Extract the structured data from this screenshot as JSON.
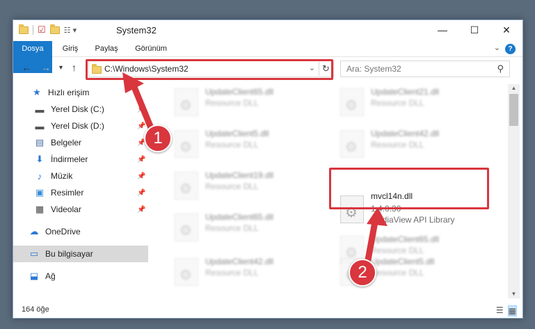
{
  "window": {
    "title": "System32",
    "controls": {
      "minimize": "—",
      "maximize": "☐",
      "close": "✕"
    }
  },
  "ribbon": {
    "tabs": [
      "Dosya",
      "Giriş",
      "Paylaş",
      "Görünüm"
    ],
    "help": "?"
  },
  "address": {
    "path": "C:\\Windows\\System32",
    "refresh_icon": "↻"
  },
  "search": {
    "placeholder": "Ara: System32"
  },
  "sidebar": {
    "items": [
      {
        "label": "Hızlı erişim",
        "icon": "star-icon",
        "glyph": "★",
        "color": "#2b78d4",
        "pinned": false
      },
      {
        "label": "Yerel Disk (C:)",
        "icon": "drive-icon",
        "glyph": "▬",
        "color": "#555555",
        "pinned": true
      },
      {
        "label": "Yerel Disk (D:)",
        "icon": "drive-icon",
        "glyph": "▬",
        "color": "#555555",
        "pinned": true
      },
      {
        "label": "Belgeler",
        "icon": "documents-icon",
        "glyph": "▤",
        "color": "#4a6fa5",
        "pinned": true
      },
      {
        "label": "İndirmeler",
        "icon": "downloads-icon",
        "glyph": "⬇",
        "color": "#2b78d4",
        "pinned": true
      },
      {
        "label": "Müzik",
        "icon": "music-icon",
        "glyph": "♪",
        "color": "#2b78d4",
        "pinned": true
      },
      {
        "label": "Resimler",
        "icon": "pictures-icon",
        "glyph": "▣",
        "color": "#3a8fd6",
        "pinned": true
      },
      {
        "label": "Videolar",
        "icon": "videos-icon",
        "glyph": "▦",
        "color": "#444444",
        "pinned": true
      },
      {
        "label": "OneDrive",
        "icon": "onedrive-icon",
        "glyph": "☁",
        "color": "#2b78d4",
        "pinned": false
      },
      {
        "label": "Bu bilgisayar",
        "icon": "computer-icon",
        "glyph": "▭",
        "color": "#2b78d4",
        "pinned": false
      },
      {
        "label": "Ağ",
        "icon": "network-icon",
        "glyph": "⬓",
        "color": "#2b78d4",
        "pinned": false
      }
    ]
  },
  "files": [
    {
      "name": "UpdateClient65.dll",
      "type": "Resource DLL"
    },
    {
      "name": "UpdateClient21.dll",
      "type": "Resource DLL"
    },
    {
      "name": "UpdateClient5.dll",
      "type": "Resource DLL"
    },
    {
      "name": "UpdateClient42.dll",
      "type": "Resource DLL"
    },
    {
      "name": "UpdateClient19.dll",
      "type": "Resource DLL"
    },
    {
      "name": "mvcl14n.dll",
      "version": "1.4.0.30",
      "type": "MediaView API Library"
    },
    {
      "name": "UpdateClient65.dll",
      "type": "Resource DLL"
    },
    {
      "name": "UpdateClient65.dll",
      "type": "Resource DLL"
    },
    {
      "name": "UpdateClient42.dll",
      "type": "Resource DLL"
    },
    {
      "name": "UpdateClient5.dll",
      "type": "Resource DLL"
    }
  ],
  "status": {
    "count": "164 öğe"
  },
  "annotations": {
    "badge1": "1",
    "badge2": "2",
    "color": "#d9363e"
  }
}
